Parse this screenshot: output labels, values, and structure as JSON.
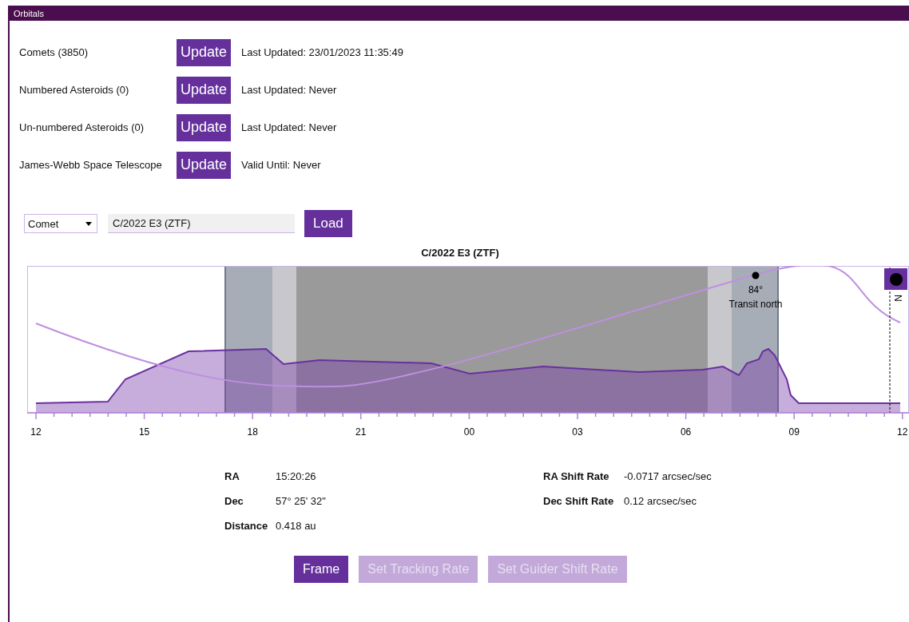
{
  "window": {
    "title": "Orbitals"
  },
  "catalogs": [
    {
      "name": "Comets (3850)",
      "button": "Update",
      "status": "Last Updated: 23/01/2023 11:35:49"
    },
    {
      "name": "Numbered Asteroids (0)",
      "button": "Update",
      "status": "Last Updated: Never"
    },
    {
      "name": "Un-numbered Asteroids (0)",
      "button": "Update",
      "status": "Last Updated: Never"
    },
    {
      "name": "James-Webb Space Telescope",
      "button": "Update",
      "status": "Valid Until: Never"
    }
  ],
  "selector": {
    "type": "Comet",
    "value": "C/2022 E3 (ZTF)",
    "button": "Load"
  },
  "chart": {
    "title": "C/2022 E3 (ZTF)",
    "x_labels": [
      "12",
      "15",
      "18",
      "21",
      "00",
      "03",
      "06",
      "09",
      "12"
    ],
    "transit_altitude": "84°",
    "transit_label": "Transit north",
    "marker_label": "N"
  },
  "info_left": [
    {
      "label": "RA",
      "value": "15:20:26"
    },
    {
      "label": "Dec",
      "value": "57° 25' 32\""
    },
    {
      "label": "Distance",
      "value": "0.418 au"
    }
  ],
  "info_right": [
    {
      "label": "RA Shift Rate",
      "value": "-0.0717 arcsec/sec"
    },
    {
      "label": "Dec Shift Rate",
      "value": "0.12 arcsec/sec"
    }
  ],
  "buttons": [
    {
      "label": "Frame",
      "disabled": false
    },
    {
      "label": "Set Tracking Rate",
      "disabled": true
    },
    {
      "label": "Set Guider Shift Rate",
      "disabled": true
    }
  ]
}
